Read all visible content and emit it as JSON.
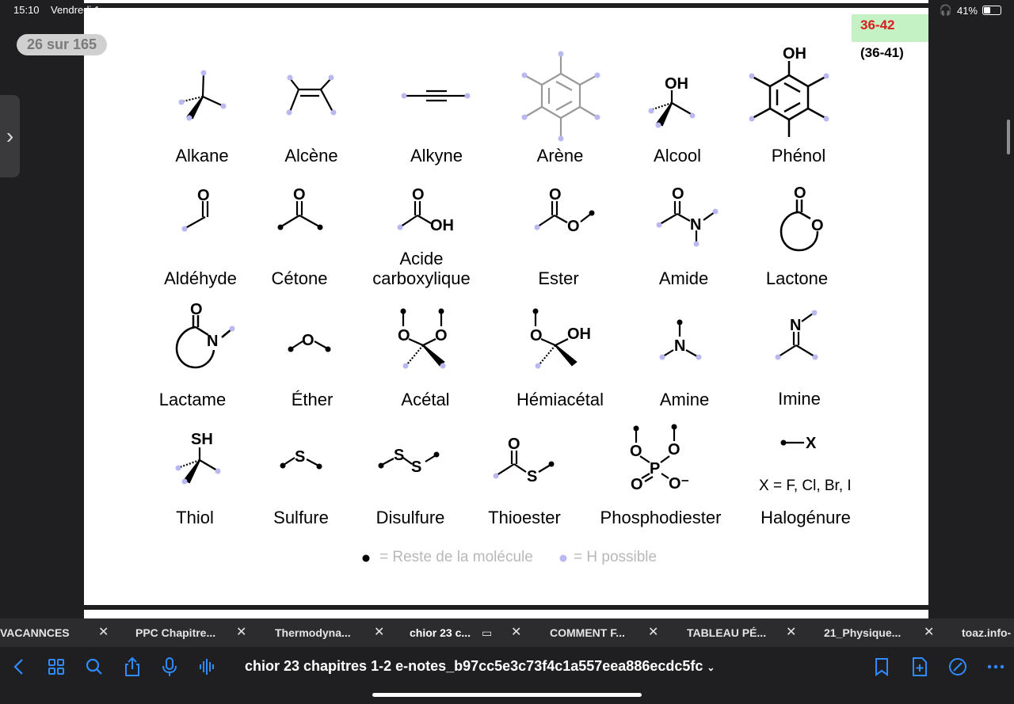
{
  "status": {
    "time": "15:10",
    "date": "Vendredi 1",
    "battery": "41%"
  },
  "page_counter": "26 sur 165",
  "slide": {
    "code": "36-42",
    "code_sub": "(36-41)",
    "groups": [
      {
        "label": "Alkane"
      },
      {
        "label": "Alcène"
      },
      {
        "label": "Alkyne"
      },
      {
        "label": "Arène"
      },
      {
        "label": "Alcool"
      },
      {
        "label": "Phénol"
      },
      {
        "label": "Aldéhyde"
      },
      {
        "label": "Cétone"
      },
      {
        "label": "Acide"
      },
      {
        "label": "carboxylique"
      },
      {
        "label": "Ester"
      },
      {
        "label": "Amide"
      },
      {
        "label": "Lactone"
      },
      {
        "label": "Lactame"
      },
      {
        "label": "Éther"
      },
      {
        "label": "Acétal"
      },
      {
        "label": "Hémiacétal"
      },
      {
        "label": "Amine"
      },
      {
        "label": "Imine"
      },
      {
        "label": "Thiol"
      },
      {
        "label": "Sulfure"
      },
      {
        "label": "Disulfure"
      },
      {
        "label": "Thioester"
      },
      {
        "label": "Phosphodiester"
      },
      {
        "label": "Halogénure"
      }
    ],
    "atoms": {
      "oh": "OH",
      "o": "O",
      "n": "N",
      "sh": "SH",
      "s": "S",
      "p": "P",
      "ominus": "O⁻",
      "x": "X"
    },
    "halide_note": "X = F, Cl, Br, I",
    "legend": {
      "rest": "= Reste de la molécule",
      "h": "= H possible"
    },
    "colors": {
      "h_dot": "#b9b8f0",
      "code_bg": "#c4f2c4",
      "code_text": "#d81e1e"
    }
  },
  "tabs": [
    {
      "label": "VACANNCES"
    },
    {
      "label": "PPC Chapitre..."
    },
    {
      "label": "Thermodyna..."
    },
    {
      "label": "chior 23 c..."
    },
    {
      "label": "COMMENT F..."
    },
    {
      "label": "TABLEAU PÉ..."
    },
    {
      "label": "21_Physique..."
    },
    {
      "label": "toaz.info-"
    }
  ],
  "toolbar": {
    "title": "chior 23 chapitres 1-2 e-notes_b97cc5e3c73f4c1a557eea886ecdc5fc",
    "icons": [
      "back-icon",
      "grid-icon",
      "search-icon",
      "share-icon",
      "microphone-icon",
      "audio-waveform-icon",
      "bookmark-icon",
      "add-page-icon",
      "markup-icon",
      "more-icon"
    ]
  }
}
